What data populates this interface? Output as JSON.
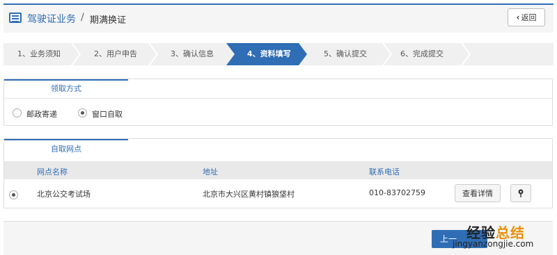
{
  "header": {
    "title": "驾驶证业务",
    "separator": "/",
    "subtitle": "期满换证",
    "back_label": "返回"
  },
  "steps": [
    {
      "label": "1、业务须知",
      "active": false
    },
    {
      "label": "2、用户申告",
      "active": false
    },
    {
      "label": "3、确认信息",
      "active": false
    },
    {
      "label": "4、资料填写",
      "active": true
    },
    {
      "label": "5、确认提交",
      "active": false
    },
    {
      "label": "6、完成提交",
      "active": false
    }
  ],
  "pickup_method": {
    "tab_label": "领取方式",
    "options": [
      {
        "label": "邮政寄递",
        "checked": false
      },
      {
        "label": "窗口自取",
        "checked": true
      }
    ]
  },
  "pickup_point": {
    "tab_label": "自取网点",
    "columns": [
      "网点名称",
      "地址",
      "联系电话"
    ],
    "rows": [
      {
        "name": "北京公交考试场",
        "address": "北京市大兴区黄村镇狼垡村",
        "phone": "010-83702759",
        "selected": true
      }
    ],
    "detail_button": "查看详情"
  },
  "footer": {
    "next_label": "上一"
  },
  "watermark": {
    "top_text": "经验",
    "top_accent": "总结",
    "bottom_text": "jingyanzongjie.com"
  },
  "colors": {
    "accent": "#2f6db5",
    "step_active": "#2f6db5",
    "watermark_accent": "#e8910c"
  }
}
